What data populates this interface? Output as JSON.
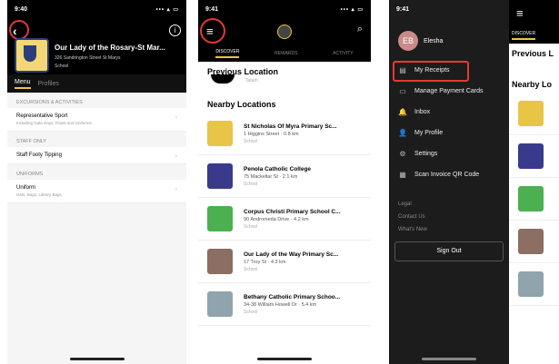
{
  "status": {
    "time": "9:40",
    "time2": "9:41",
    "icons": "••• ▴ ▭"
  },
  "screen1": {
    "school_title": "Our Lady of the Rosary-St Mar...",
    "address": "326 Sandrington Street St Marys",
    "type": "School",
    "tabs": [
      "Menu",
      "Profiles"
    ],
    "sections": [
      {
        "header": "EXCURSIONS & ACTIVITIES",
        "rows": [
          {
            "title": "Representative Sport",
            "sub": "Including Gala Days, Finals and Uniforms"
          }
        ]
      },
      {
        "header": "STAFF ONLY",
        "rows": [
          {
            "title": "Staff Footy Tipping",
            "sub": ""
          }
        ]
      },
      {
        "header": "UNIFORMS",
        "rows": [
          {
            "title": "Uniform",
            "sub": "Hats, Bags, Library Bags"
          }
        ]
      }
    ]
  },
  "screen2": {
    "tabs": [
      "DISCOVER",
      "REWARDS",
      "ACTIVITY"
    ],
    "prev_title": "Previous Location",
    "prev_sub": "Tatam",
    "nearby_title": "Nearby Locations",
    "locations": [
      {
        "name": "St Nicholas Of Myra Primary Sc...",
        "addr": "1 Higgins Street · 0.8 km",
        "type": "School",
        "color": "#e8c546"
      },
      {
        "name": "Penola Catholic College",
        "addr": "75 Mackellar St · 2.1 km",
        "type": "School",
        "color": "#3a3a8c"
      },
      {
        "name": "Corpus Christi Primary School C...",
        "addr": "90 Andromeda Drive · 4.2 km",
        "type": "School",
        "color": "#4caf50"
      },
      {
        "name": "Our Lady of the Way Primary Sc...",
        "addr": "17 Troy St · 4.3 km",
        "type": "School",
        "color": "#8d6e63"
      },
      {
        "name": "Bethany Catholic Primary Schoo...",
        "addr": "34-38 William Howell Dr · 5.4 km",
        "type": "School",
        "color": "#90a4ae"
      }
    ]
  },
  "screen3": {
    "avatar": "EB",
    "name": "Elesha",
    "menu": [
      {
        "label": "My Receipts",
        "icon": "▤"
      },
      {
        "label": "Manage Payment Cards",
        "icon": "▭"
      },
      {
        "label": "Inbox",
        "icon": "🔔"
      },
      {
        "label": "My Profile",
        "icon": "👤"
      },
      {
        "label": "Settings",
        "icon": "⚙"
      },
      {
        "label": "Scan Invoice QR Code",
        "icon": "▦"
      }
    ],
    "links": [
      "Legal",
      "Contact Us",
      "What's New"
    ],
    "signout": "Sign Out"
  },
  "screen4": {
    "tab": "DISCOVER",
    "heading": "Previous L",
    "nearby": "Nearby Lo"
  }
}
